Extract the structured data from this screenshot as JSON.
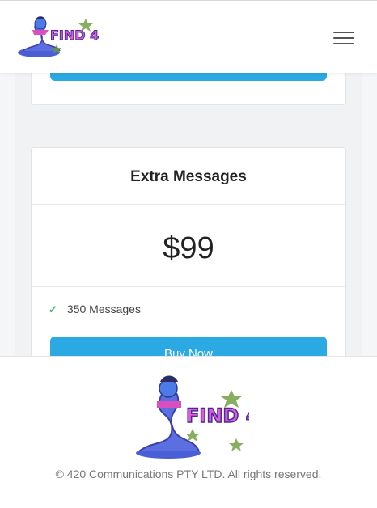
{
  "header": {
    "logo_text": "FIND 420",
    "menu_icon": "hamburger-menu-icon"
  },
  "pricing": {
    "card_title": "Extra Messages",
    "price": "$99",
    "features": [
      {
        "icon": "check-icon",
        "text": "350 Messages"
      }
    ],
    "button_label": "Buy Now"
  },
  "footer": {
    "logo_text": "FIND 420",
    "copyright": "© 420 Communications PTY LTD. All rights reserved."
  },
  "colors": {
    "accent": "#2ba9e2",
    "check": "#3cb371",
    "logo_purple": "#6a3fd0",
    "logo_pink": "#e05bd8"
  }
}
